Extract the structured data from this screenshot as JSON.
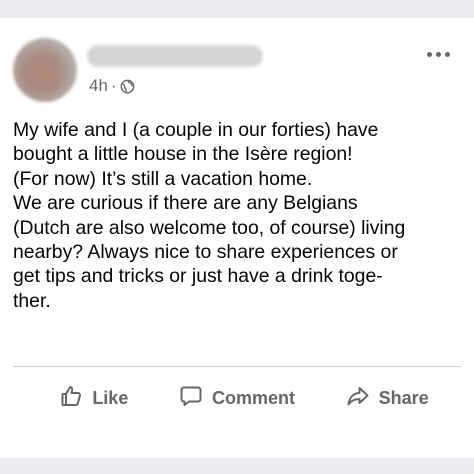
{
  "post": {
    "timestamp": "4h",
    "separator": "·",
    "privacy_icon": "globe-icon",
    "lines": [
      "My wife and I (a couple in our forties) have",
      "bought a little house in the Isère region!",
      "(For now) It’s still a vacation home.",
      "We are curious if there are any Belgians",
      "(Dutch are also welcome too, of course) living",
      "nearby? Always nice to share experiences or",
      "get tips and tricks or just have a drink toge-",
      "ther."
    ]
  },
  "actions": {
    "like": "Like",
    "comment": "Comment",
    "share": "Share"
  },
  "colors": {
    "background": "#eaebee",
    "card": "#ffffff",
    "text": "#050505",
    "secondary": "#65676b"
  }
}
